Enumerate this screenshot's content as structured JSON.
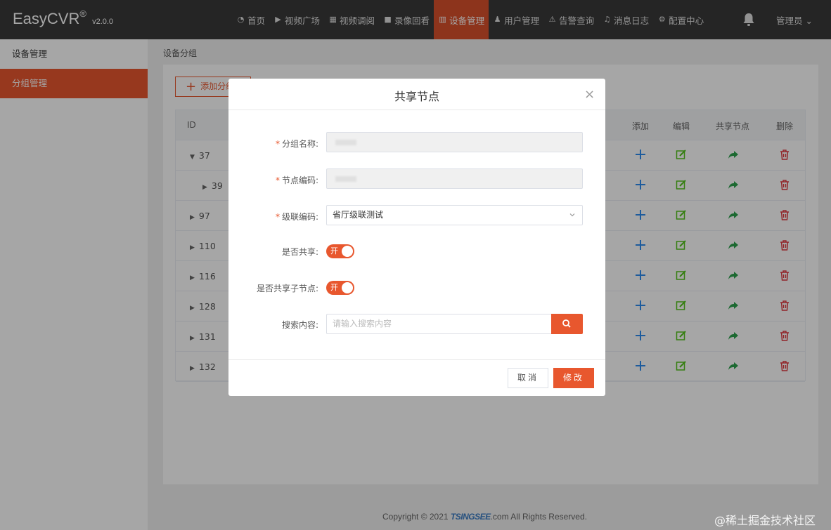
{
  "brand": {
    "name": "EasyCVR",
    "reg": "®",
    "version": "v2.0.0"
  },
  "nav": {
    "items": [
      {
        "label": "首页",
        "icon": "dashboard-icon"
      },
      {
        "label": "视频广场",
        "icon": "play-icon"
      },
      {
        "label": "视频调阅",
        "icon": "grid-icon"
      },
      {
        "label": "录像回看",
        "icon": "video-camera-icon"
      },
      {
        "label": "设备管理",
        "icon": "book-icon",
        "active": true
      },
      {
        "label": "用户管理",
        "icon": "user-icon"
      },
      {
        "label": "告警查询",
        "icon": "alarm-icon"
      },
      {
        "label": "消息日志",
        "icon": "bell-icon"
      },
      {
        "label": "配置中心",
        "icon": "gear-icon"
      }
    ],
    "admin": "管理员 ⌄"
  },
  "sidebar": {
    "items": [
      {
        "label": "设备管理"
      },
      {
        "label": "分组管理",
        "active": true
      }
    ]
  },
  "breadcrumb": "设备分组",
  "toolbar": {
    "add_label": "添加分组"
  },
  "table": {
    "headers": {
      "id": "ID",
      "add": "添加",
      "edit": "编辑",
      "share": "共享节点",
      "delete": "删除"
    },
    "rows": [
      {
        "id": "37",
        "caret": "▼"
      },
      {
        "id": "39",
        "caret": "▶"
      },
      {
        "id": "97",
        "caret": "▶"
      },
      {
        "id": "110",
        "caret": "▶"
      },
      {
        "id": "116",
        "caret": "▶"
      },
      {
        "id": "128",
        "caret": "▶"
      },
      {
        "id": "131",
        "caret": "▶"
      },
      {
        "id": "132",
        "caret": "▶"
      }
    ]
  },
  "modal": {
    "title": "共享节点",
    "close": "×",
    "fields": {
      "group_name_label": "分组名称:",
      "node_code_label": "节点编码:",
      "cascade_label": "级联编码:",
      "cascade_value": "省厅级联测试",
      "share_label": "是否共享:",
      "share_child_label": "是否共享子节点:",
      "toggle_on": "开",
      "search_label": "搜索内容:",
      "search_placeholder": "请输入搜索内容"
    },
    "required_mark": "*",
    "cancel": "取消",
    "confirm": "修改"
  },
  "footer": {
    "pre": "Copyright © 2021 ",
    "brand": "TSINGSEE",
    "post": ".com All Rights Reserved."
  },
  "watermark": "@稀土掘金技术社区",
  "colors": {
    "accent": "#e8572e",
    "topbar": "#3a3a3a",
    "add_icon": "#2d8cf0",
    "edit_icon": "#52c41a",
    "share_icon": "#2ba24c",
    "delete_icon": "#e0383e"
  }
}
